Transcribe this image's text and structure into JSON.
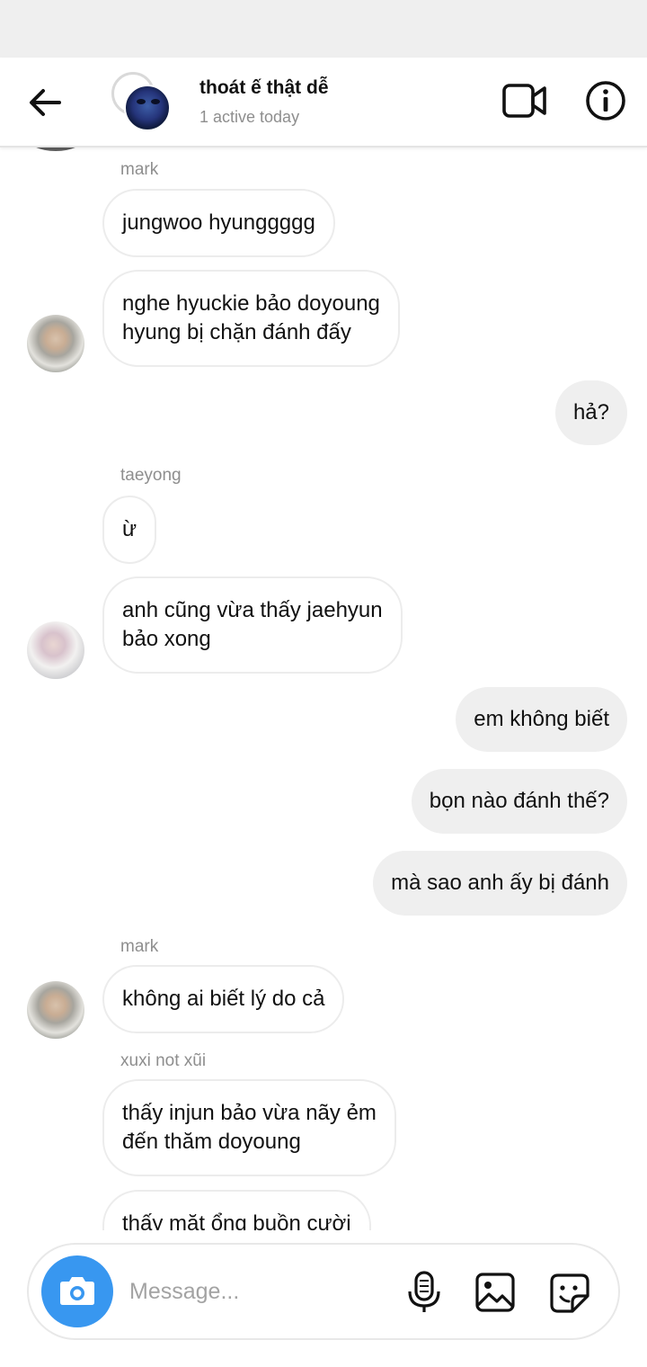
{
  "header": {
    "title": "thoát ế thật dễ",
    "subtitle": "1 active today",
    "icons": {
      "back": "back-arrow-icon",
      "video": "video-call-icon",
      "info": "info-icon"
    }
  },
  "messages": {
    "m1_sender": "mark",
    "m1": "jungwoo hyunggggg",
    "m2": "nghe hyuckie bảo doyoung",
    "m2b": "hyung bị chặn đánh đấy",
    "m3": "hả?",
    "m4_sender": "taeyong",
    "m4": "ừ",
    "m5": "anh cũng vừa thấy jaehyun",
    "m5b": "bảo xong",
    "m6": "em không biết",
    "m7": "bọn nào đánh thế?",
    "m8": "mà sao anh ấy bị đánh",
    "m9_sender": "mark",
    "m9": "không ai biết lý do cả",
    "m10_sender": "xuxi not xũi",
    "m10": "thấy injun bảo vừa nãy ẻm",
    "m10b": "đến  thăm  doyoung",
    "m11": "thấy  mặt  ổng buồn cười"
  },
  "composer": {
    "placeholder": "Message...",
    "icons": {
      "camera": "camera-icon",
      "mic": "microphone-icon",
      "gallery": "gallery-icon",
      "sticker": "sticker-icon"
    }
  },
  "colors": {
    "accent": "#3897f0",
    "incoming_bubble": "#ffffff",
    "outgoing_bubble": "#efefef",
    "meta_text": "#8e8e8e"
  }
}
